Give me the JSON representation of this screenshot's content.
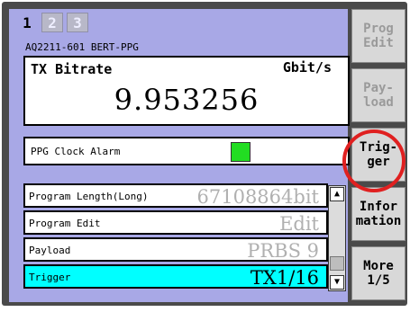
{
  "tabs": [
    {
      "label": "1",
      "active": true
    },
    {
      "label": "2",
      "active": false
    },
    {
      "label": "3",
      "active": false
    }
  ],
  "model": "AQ2211-601 BERT-PPG",
  "tx_bitrate": {
    "title": "TX Bitrate",
    "unit": "Gbit/s",
    "value": "9.953256"
  },
  "alarm": {
    "label": "PPG Clock Alarm",
    "status_color": "#22dd22"
  },
  "rows": [
    {
      "label": "Program Length(Long)",
      "value": "67108864bit",
      "selected": false
    },
    {
      "label": "Program Edit",
      "value": "Edit",
      "selected": false
    },
    {
      "label": "Payload",
      "value": "PRBS 9",
      "selected": false
    },
    {
      "label": "Trigger",
      "value": "TX1/16",
      "selected": true
    }
  ],
  "scrollbar": {
    "up_icon": "▲",
    "down_icon": "▼"
  },
  "softkeys": [
    {
      "label": "Prog\nEdit",
      "enabled": false
    },
    {
      "label": "Pay-\nload",
      "enabled": false
    },
    {
      "label": "Trig-\nger",
      "enabled": true,
      "highlighted": true
    },
    {
      "label": "Infor\nmation",
      "enabled": true
    },
    {
      "label": "More\n1/5",
      "enabled": true
    }
  ],
  "colors": {
    "panel": "#a8a8e6",
    "selected_row": "#00ffff",
    "highlight_ring": "#e02020"
  }
}
